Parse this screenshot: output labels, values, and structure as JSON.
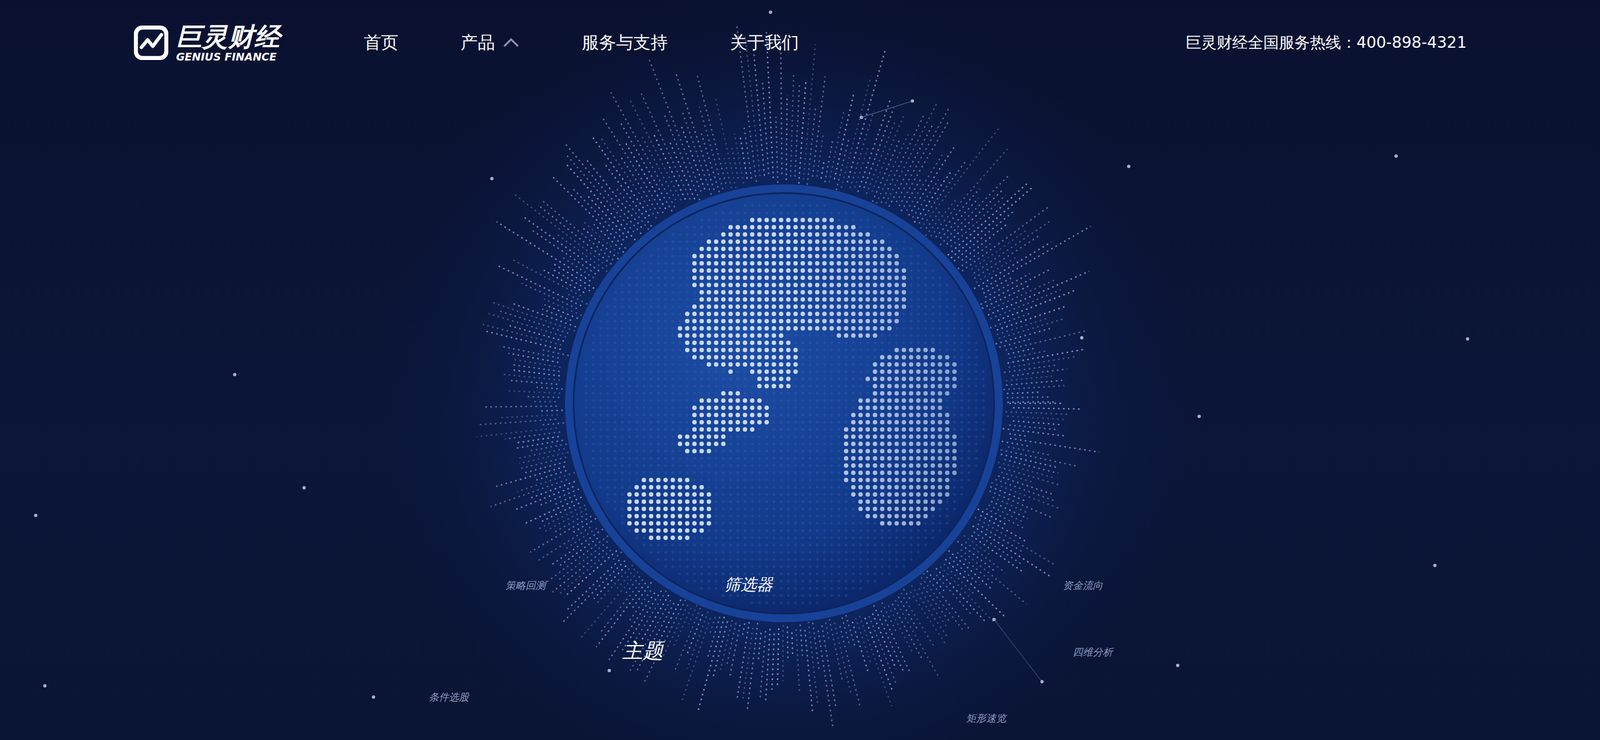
{
  "logo": {
    "name": "巨灵财经",
    "english": "GENIUS FINANCE"
  },
  "nav": [
    {
      "label": "首页",
      "has_dropdown": false,
      "expanded": false
    },
    {
      "label": "产品",
      "has_dropdown": true,
      "expanded": true
    },
    {
      "label": "服务与支持",
      "has_dropdown": false,
      "expanded": false
    },
    {
      "label": "关于我们",
      "has_dropdown": false,
      "expanded": false
    }
  ],
  "hotline": "巨灵财经全国服务热线：400-898-4321",
  "orbit_labels": [
    {
      "text": "筛选器",
      "kind": "secondary"
    },
    {
      "text": "主题",
      "kind": "primary"
    },
    {
      "text": "策略回测",
      "kind": "tertiary"
    },
    {
      "text": "资金流向",
      "kind": "tertiary"
    },
    {
      "text": "四维分析",
      "kind": "tertiary"
    },
    {
      "text": "条件选股",
      "kind": "tertiary"
    },
    {
      "text": "矩形速览",
      "kind": "tertiary"
    }
  ]
}
